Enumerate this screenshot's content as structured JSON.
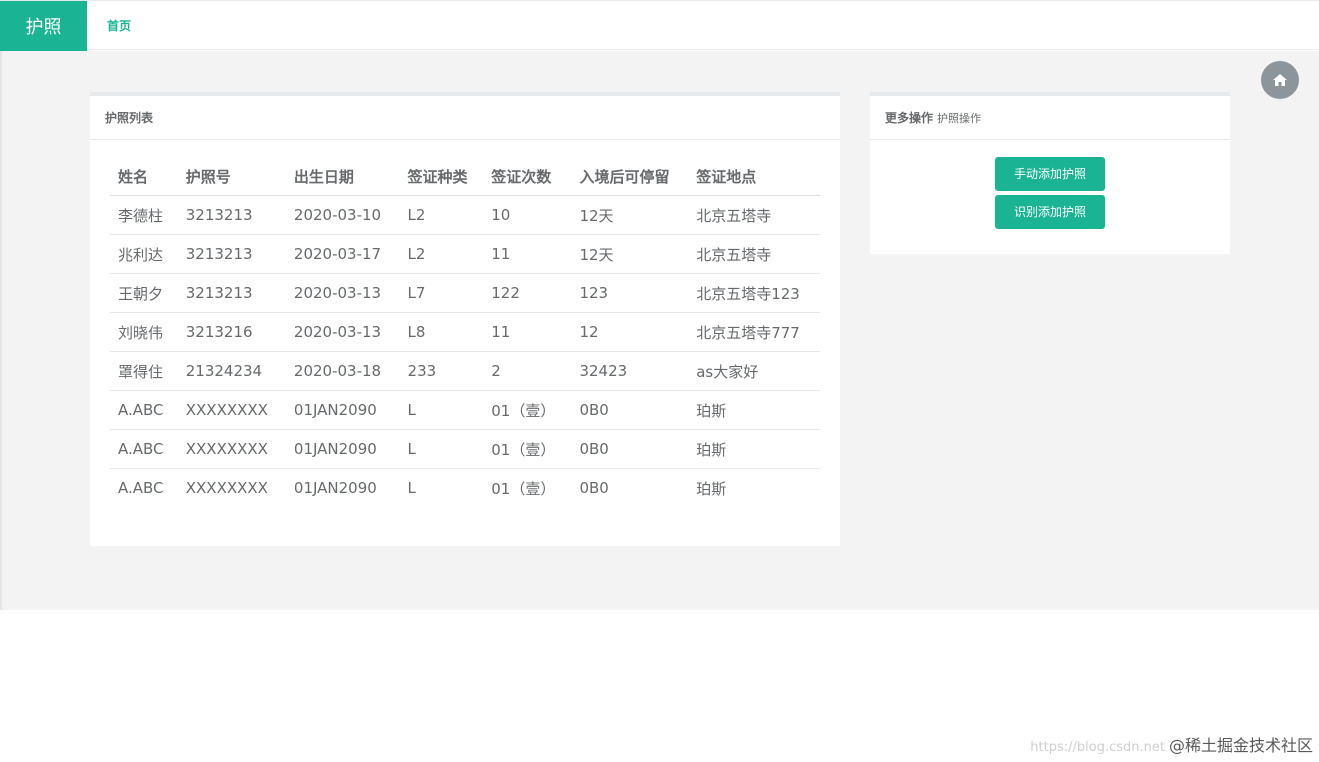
{
  "header": {
    "brand": "护照",
    "nav_home": "首页"
  },
  "list_panel": {
    "title": "护照列表",
    "columns": [
      "姓名",
      "护照号",
      "出生日期",
      "签证种类",
      "签证次数",
      "入境后可停留",
      "签证地点"
    ],
    "rows": [
      [
        "李德柱",
        "3213213",
        "2020-03-10",
        "L2",
        "10",
        "12天",
        "北京五塔寺"
      ],
      [
        "兆利达",
        "3213213",
        "2020-03-17",
        "L2",
        "11",
        "12天",
        "北京五塔寺"
      ],
      [
        "王朝夕",
        "3213213",
        "2020-03-13",
        "L7",
        "122",
        "123",
        "北京五塔寺123"
      ],
      [
        "刘晓伟",
        "3213216",
        "2020-03-13",
        "L8",
        "11",
        "12",
        "北京五塔寺777"
      ],
      [
        "罩得住",
        "21324234",
        "2020-03-18",
        "233",
        "2",
        "32423",
        "as大家好"
      ],
      [
        "A.ABC",
        "XXXXXXXX",
        "01JAN2090",
        "L",
        "01（壹）",
        "0B0",
        "珀斯"
      ],
      [
        "A.ABC",
        "XXXXXXXX",
        "01JAN2090",
        "L",
        "01（壹）",
        "0B0",
        "珀斯"
      ],
      [
        "A.ABC",
        "XXXXXXXX",
        "01JAN2090",
        "L",
        "01（壹）",
        "0B0",
        "珀斯"
      ]
    ]
  },
  "ops_panel": {
    "title": "更多操作",
    "subtitle": "护照操作",
    "manual_add": "手动添加护照",
    "recognize_add": "识别添加护照"
  },
  "home_button_icon": "home-icon",
  "watermark": {
    "faint": "https://blog.csdn.net",
    "text": "@稀土掘金技术社区"
  },
  "colors": {
    "accent": "#1ab394",
    "background": "#f3f3f4",
    "fab": "#8d959c"
  }
}
